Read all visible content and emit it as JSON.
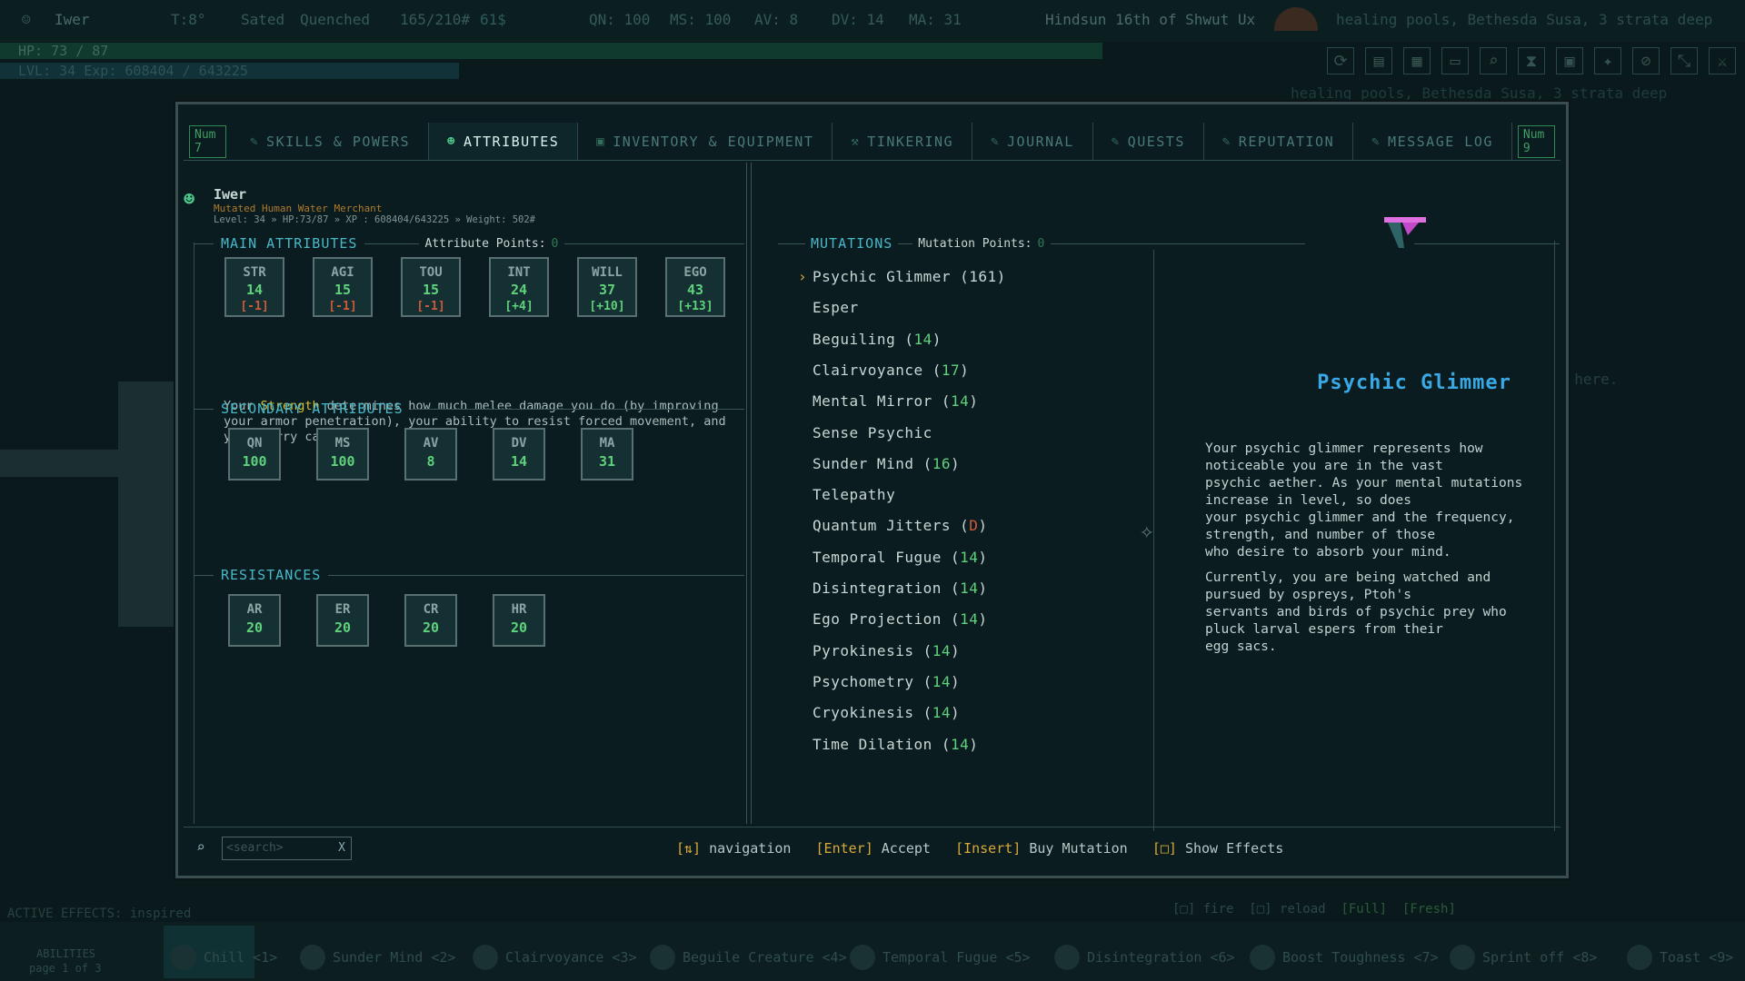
{
  "hud": {
    "name": "Iwer",
    "turn": "T:8°",
    "status1": "Sated",
    "status2": "Quenched",
    "weight": "165/210#",
    "money": "61$",
    "qn": "QN: 100",
    "ms": "MS: 100",
    "av": "AV: 8",
    "dv": "DV: 14",
    "ma": "MA: 31",
    "date": "Hindsun 16th of Shwut Ux",
    "location": "healing pools, Bethesda Susa, 3 strata deep",
    "hp": "HP: 73 / 87",
    "lvl": "LVL: 34 Exp: 608404 / 643225"
  },
  "tabs": {
    "left_key": "Num 7",
    "right_key": "Num 9",
    "items": [
      {
        "label": "SKILLS & POWERS",
        "icon": "✎"
      },
      {
        "label": "ATTRIBUTES",
        "icon": "☻"
      },
      {
        "label": "INVENTORY & EQUIPMENT",
        "icon": "▣"
      },
      {
        "label": "TINKERING",
        "icon": "⚒"
      },
      {
        "label": "JOURNAL",
        "icon": "✎"
      },
      {
        "label": "QUESTS",
        "icon": "✎"
      },
      {
        "label": "REPUTATION",
        "icon": "✎"
      },
      {
        "label": "MESSAGE LOG",
        "icon": "✎"
      }
    ]
  },
  "character": {
    "name": "Iwer",
    "desc": "Mutated Human Water Merchant",
    "stats": "Level: 34 » HP:73/87 » XP : 608404/643225 » Weight: 502#"
  },
  "main_attributes": {
    "title": "MAIN ATTRIBUTES",
    "points_label": "Attribute Points:",
    "points": "0",
    "items": [
      {
        "k": "STR",
        "v": "14",
        "m": "[-1]",
        "c": "#d05a3a"
      },
      {
        "k": "AGI",
        "v": "15",
        "m": "[-1]",
        "c": "#d05a3a"
      },
      {
        "k": "TOU",
        "v": "15",
        "m": "[-1]",
        "c": "#d05a3a"
      },
      {
        "k": "INT",
        "v": "24",
        "m": "[+4]",
        "c": "#5fd27b"
      },
      {
        "k": "WILL",
        "v": "37",
        "m": "[+10]",
        "c": "#5fd27b"
      },
      {
        "k": "EGO",
        "v": "43",
        "m": "[+13]",
        "c": "#5fd27b"
      }
    ],
    "desc_a": "Your ",
    "desc_b": "Strength",
    "desc_c": " determines how much melee damage you do (by improving your armor penetration), your ability to resist forced movement, and your carry capacity."
  },
  "secondary_attributes": {
    "title": "SECONDARY ATTRIBUTES",
    "items": [
      {
        "k": "QN",
        "v": "100"
      },
      {
        "k": "MS",
        "v": "100"
      },
      {
        "k": "AV",
        "v": "8"
      },
      {
        "k": "DV",
        "v": "14"
      },
      {
        "k": "MA",
        "v": "31"
      }
    ]
  },
  "resistances": {
    "title": "RESISTANCES",
    "items": [
      {
        "k": "AR",
        "v": "20"
      },
      {
        "k": "ER",
        "v": "20"
      },
      {
        "k": "CR",
        "v": "20"
      },
      {
        "k": "HR",
        "v": "20"
      }
    ]
  },
  "mutations": {
    "title": "MUTATIONS",
    "points_label": "Mutation Points:",
    "points": "0",
    "items": [
      {
        "name": "Psychic Glimmer",
        "lvl": "161",
        "col": "#c9d7d5"
      },
      {
        "name": "Esper",
        "lvl": ""
      },
      {
        "name": "Beguiling",
        "lvl": "14"
      },
      {
        "name": "Clairvoyance",
        "lvl": "17"
      },
      {
        "name": "Mental Mirror",
        "lvl": "14"
      },
      {
        "name": "Sense Psychic",
        "lvl": ""
      },
      {
        "name": "Sunder Mind",
        "lvl": "16"
      },
      {
        "name": "Telepathy",
        "lvl": ""
      },
      {
        "name": "Quantum Jitters",
        "lvl": "D",
        "col": "#d05a3a"
      },
      {
        "name": "Temporal Fugue",
        "lvl": "14"
      },
      {
        "name": "Disintegration",
        "lvl": "14"
      },
      {
        "name": "Ego Projection",
        "lvl": "14"
      },
      {
        "name": "Pyrokinesis",
        "lvl": "14"
      },
      {
        "name": "Psychometry",
        "lvl": "14"
      },
      {
        "name": "Cryokinesis",
        "lvl": "14"
      },
      {
        "name": "Time Dilation",
        "lvl": "14"
      }
    ]
  },
  "detail": {
    "title": "Psychic Glimmer",
    "p1": [
      "Your psychic glimmer represents how",
      "noticeable you are in the vast",
      "psychic aether. As your mental mutations",
      "increase in level, so does",
      "your psychic glimmer and the frequency,",
      "strength, and number of those",
      "who desire to absorb your mind."
    ],
    "p2": [
      "Currently, you are being watched and",
      "pursued by ospreys, Ptoh's",
      "servants and birds of psychic prey who",
      "pluck larval espers from their",
      "egg sacs."
    ]
  },
  "footer": {
    "search_placeholder": "<search>",
    "search_clear": "X",
    "nav_key": "[⇅]",
    "nav": "navigation",
    "enter_key": "[Enter]",
    "enter": "Accept",
    "insert_key": "[Insert]",
    "insert": "Buy Mutation",
    "effects_key": "[□]",
    "effects": "Show Effects"
  },
  "bottom": {
    "active_effects": "ACTIVE EFFECTS: inspired",
    "abilities": "ABILITIES",
    "page": "page 1 of 3",
    "fire": "[□] fire",
    "reload": "[□] reload",
    "full": "[Full]",
    "fresh": "[Fresh]",
    "items": [
      "Chill <1>",
      "Sunder Mind <2>",
      "Clairvoyance <3>",
      "Beguile Creature <4>",
      "Temporal Fugue <5>",
      "Disintegration <6>",
      "Boost Toughness <7>",
      "Sprint   off <8>",
      "Toast <9>"
    ]
  },
  "bg": {
    "here": "s here."
  }
}
